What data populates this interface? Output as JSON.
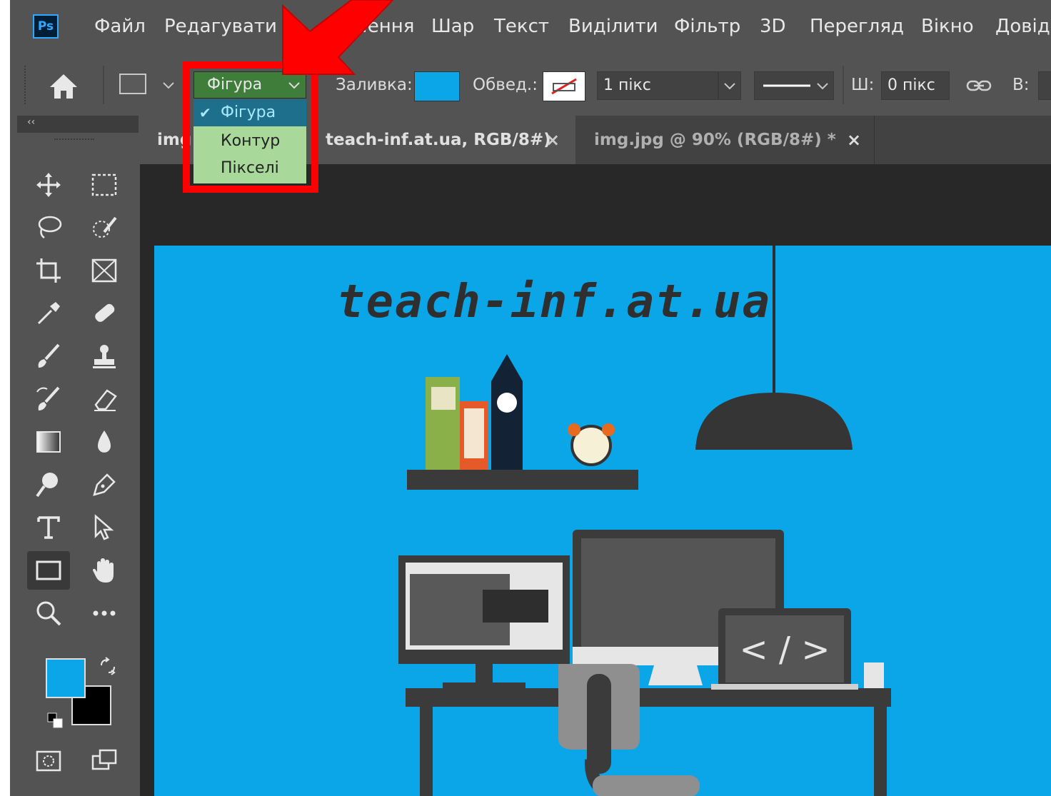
{
  "app": {
    "logo": "Ps"
  },
  "menu": [
    "Файл",
    "Редагувати",
    "...ення",
    "Шар",
    "Текст",
    "Виділити",
    "Фільтр",
    "3D",
    "Перегляд",
    "Вікно",
    "Довід"
  ],
  "options": {
    "mode_selected": "Фігура",
    "fill_label": "Заливка:",
    "stroke_label": "Обвед.:",
    "stroke_width": "1 пікс",
    "w_label": "Ш:",
    "w_value": "0 пікс",
    "h_label": "В:"
  },
  "dropdown": {
    "items": [
      "Фігура",
      "Контур",
      "Пікселі"
    ],
    "selected": "Фігура"
  },
  "tabs": {
    "active_left": "img",
    "active_right": "teach-inf.at.ua, RGB/8#)",
    "inactive": "img.jpg @ 90% (RGB/8#) *"
  },
  "canvas": {
    "site_text": "teach-inf.at.ua",
    "screen_code": "< / >"
  },
  "colors": {
    "foreground": "#0aa6e8",
    "background": "#000000",
    "highlight": "#ff0000"
  },
  "icons": [
    "home-icon",
    "move-icon",
    "marquee-icon",
    "lasso-icon",
    "quick-select-icon",
    "crop-icon",
    "frame-icon",
    "eyedropper-icon",
    "healing-icon",
    "brush-icon",
    "stamp-icon",
    "history-brush-icon",
    "eraser-icon",
    "gradient-icon",
    "blur-icon",
    "dodge-icon",
    "pen-icon",
    "type-icon",
    "path-select-icon",
    "rectangle-icon",
    "hand-icon",
    "zoom-icon",
    "more-icon"
  ]
}
